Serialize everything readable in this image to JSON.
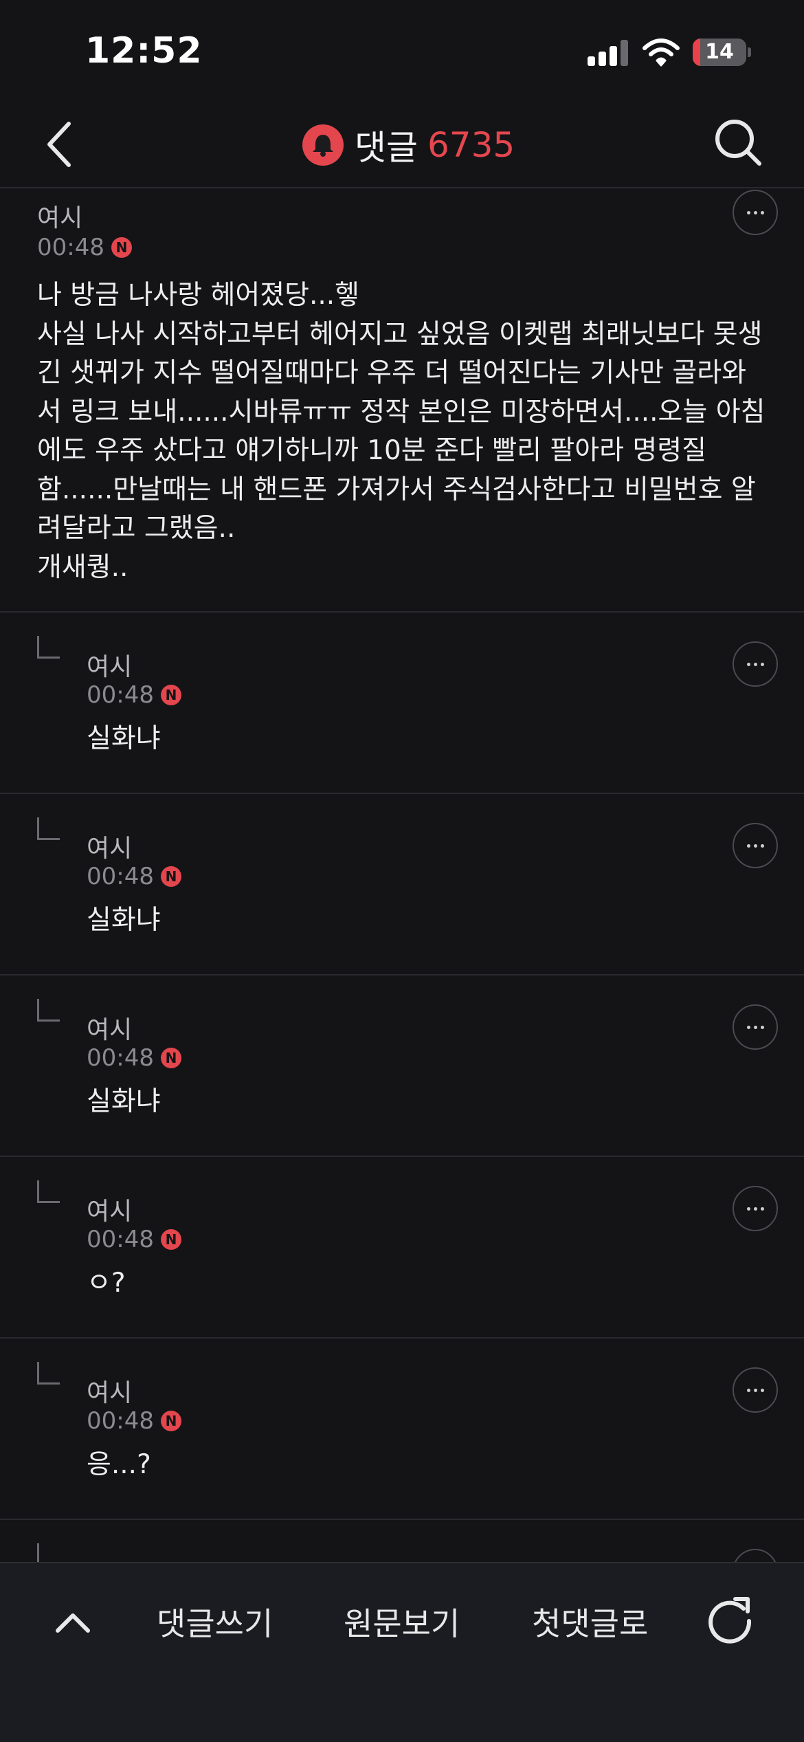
{
  "status_bar": {
    "time": "12:52",
    "battery": "14",
    "battery_level": 0.14
  },
  "header": {
    "title": "댓글",
    "count": "6735",
    "accent_color": "#e5474f"
  },
  "comments": [
    {
      "author": "여시",
      "time": "00:48",
      "badge": "N",
      "text": "나 방금 나사랑 헤어졌당...헿\n사실 나사 시작하고부터 헤어지고 싶었음 이켓랩 최래닛보다 못생\n긴 샛뀌가 지수 떨어질때마다 우주 더 떨어진다는 기사만 골라와\n서 링크 보내......시바류ㅠㅠ 정작 본인은 미장하면서....오늘 아침\n에도 우주 샀다고 얘기하니까 10분 준다 빨리 팔아라 명령질\n함......만날때는 내 핸드폰 가져가서 주식검사한다고 비밀번호 알\n려달라고 그랬음..\n개새퀑.."
    },
    {
      "author": "여시",
      "time": "00:48",
      "badge": "N",
      "text": "실화냐"
    },
    {
      "author": "여시",
      "time": "00:48",
      "badge": "N",
      "text": "실화냐"
    },
    {
      "author": "여시",
      "time": "00:48",
      "badge": "N",
      "text": "실화냐"
    },
    {
      "author": "여시",
      "time": "00:48",
      "badge": "N",
      "text": "ㅇ?"
    },
    {
      "author": "여시",
      "time": "00:48",
      "badge": "N",
      "text": "응...?"
    }
  ],
  "bottom_bar": {
    "write_comment": "댓글쓰기",
    "view_original": "원문보기",
    "first_comment": "첫댓글로"
  },
  "icons": {
    "back": "chevron-left-icon",
    "search": "search-icon",
    "title_badge": "bell-icon",
    "more": "more-horizontal-icon",
    "reply": "reply-corner-icon",
    "up": "chevron-up-icon",
    "refresh": "refresh-icon"
  }
}
